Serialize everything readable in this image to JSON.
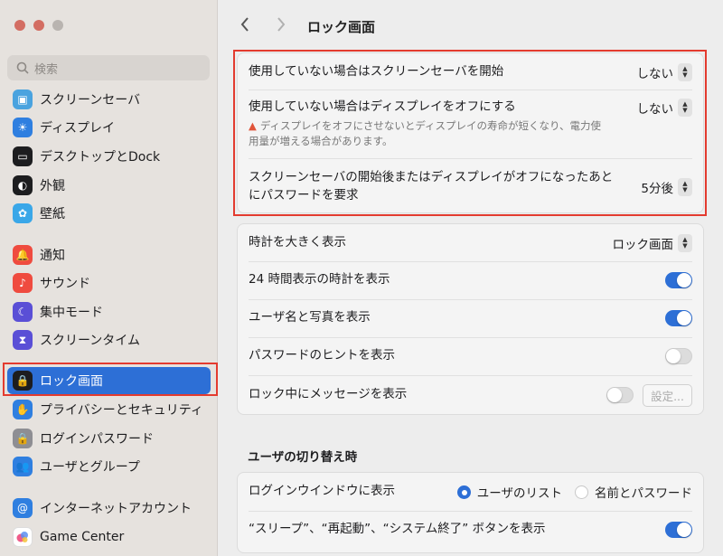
{
  "window": {
    "title": "ロック画面"
  },
  "search": {
    "placeholder": "検索"
  },
  "sidebar": {
    "items": [
      {
        "label": "スクリーンセーバ",
        "icon": "screensaver-icon",
        "color": "#4aa3df"
      },
      {
        "label": "ディスプレイ",
        "icon": "display-icon",
        "color": "#2f7fe0"
      },
      {
        "label": "デスクトップとDock",
        "icon": "dock-icon",
        "color": "#1d1d1f"
      },
      {
        "label": "外観",
        "icon": "appearance-icon",
        "color": "#1d1d1f"
      },
      {
        "label": "壁紙",
        "icon": "wallpaper-icon",
        "color": "#3aa7e8"
      },
      {
        "label": "通知",
        "icon": "notification-icon",
        "color": "#ef4b3f"
      },
      {
        "label": "サウンド",
        "icon": "sound-icon",
        "color": "#ef4b3f"
      },
      {
        "label": "集中モード",
        "icon": "moon-icon",
        "color": "#5a4fd6"
      },
      {
        "label": "スクリーンタイム",
        "icon": "hourglass-icon",
        "color": "#5a4fd6"
      },
      {
        "label": "ロック画面",
        "icon": "lock-screen-icon",
        "color": "#1d1d1f",
        "active": true
      },
      {
        "label": "プライバシーとセキュリティ",
        "icon": "hand-icon",
        "color": "#2f7fe0"
      },
      {
        "label": "ログインパスワード",
        "icon": "lock-icon",
        "color": "#8e8e93"
      },
      {
        "label": "ユーザとグループ",
        "icon": "users-icon",
        "color": "#2f7fe0"
      },
      {
        "label": "インターネットアカウント",
        "icon": "at-icon",
        "color": "#2f7fe0"
      },
      {
        "label": "Game Center",
        "icon": "game-center-icon",
        "color": "#ffffff"
      }
    ]
  },
  "toolbar": {
    "back": "‹",
    "forward": "›"
  },
  "group1": {
    "screensaver_label": "使用していない場合はスクリーンセーバを開始",
    "screensaver_value": "しない",
    "display_off_label": "使用していない場合はディスプレイをオフにする",
    "display_off_value": "しない",
    "display_off_warning": "ディスプレイをオフにさせないとディスプレイの寿命が短くなり、電力使用量が増える場合があります。",
    "password_label_line1": "スクリーンセーバの開始後またはディスプレイがオフになったあと",
    "password_label_line2": "にパスワードを要求",
    "password_value": "5分後"
  },
  "group2": {
    "large_clock_label": "時計を大きく表示",
    "large_clock_value": "ロック画面",
    "clock24_label": "24 時間表示の時計を表示",
    "clock24_on": true,
    "username_label": "ユーザ名と写真を表示",
    "username_on": true,
    "hint_label": "パスワードのヒントを表示",
    "hint_on": false,
    "message_label": "ロック中にメッセージを表示",
    "message_on": false,
    "message_settings": "設定..."
  },
  "user_switch": {
    "heading": "ユーザの切り替え時",
    "login_window_label": "ログインウインドウに表示",
    "option_list": "ユーザのリスト",
    "option_name_password": "名前とパスワード",
    "selected": "ユーザのリスト",
    "buttons_label": "“スリープ”、“再起動”、“システム終了” ボタンを表示",
    "buttons_on": true
  },
  "colors": {
    "accent": "#2d6fd6",
    "highlight": "#e33b2f"
  }
}
